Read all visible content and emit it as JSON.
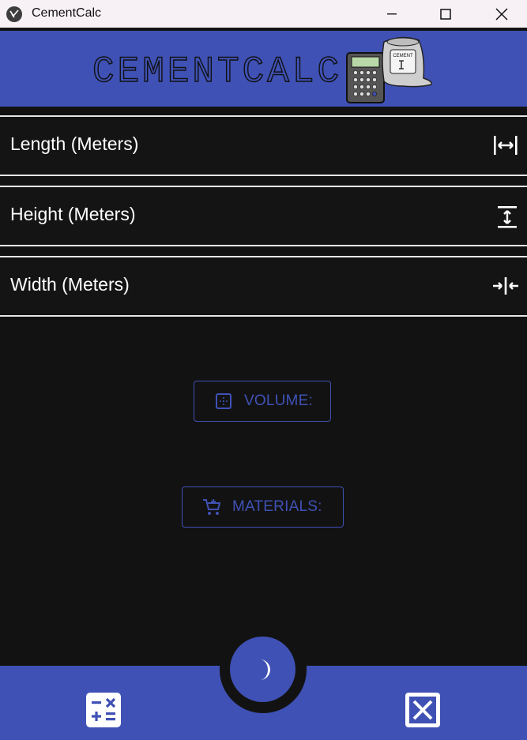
{
  "window": {
    "title": "CementCalc",
    "controls": [
      "minimize-icon",
      "maximize-icon",
      "close-icon"
    ]
  },
  "header": {
    "logo_text": "CEMENTCALC",
    "bag_label": "CEMENT"
  },
  "fields": [
    {
      "label": "Length (Meters)",
      "icon": "horizontal-measure-icon"
    },
    {
      "label": "Height (Meters)",
      "icon": "vertical-measure-icon"
    },
    {
      "label": "Width (Meters)",
      "icon": "compress-width-icon"
    }
  ],
  "buttons": {
    "volume_label": "VOLUME:",
    "materials_label": "MATERIALS:"
  },
  "bottom": {
    "calculate_icon": "calculator-icon",
    "theme_icon": "moon-icon",
    "clear_icon": "close-box-icon"
  },
  "colors": {
    "primary": "#3f51b5",
    "background": "#121212",
    "titlebar": "#f7f1f5",
    "text": "#ffffff"
  }
}
